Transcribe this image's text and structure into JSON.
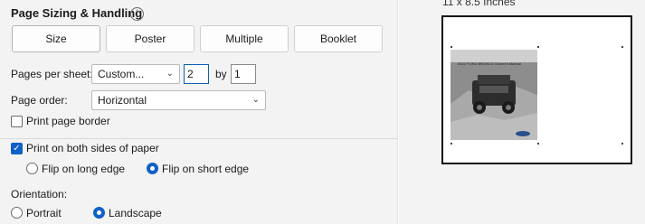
{
  "section": {
    "title": "Page Sizing & Handling",
    "info_glyph": "i"
  },
  "mode_buttons": [
    {
      "label": "Size",
      "active": true
    },
    {
      "label": "Poster",
      "active": false
    },
    {
      "label": "Multiple",
      "active": false
    },
    {
      "label": "Booklet",
      "active": false
    }
  ],
  "pages_per_sheet": {
    "label": "Pages per sheet:",
    "selected": "Custom...",
    "columns": "2",
    "by_label": "by",
    "rows": "1"
  },
  "page_order": {
    "label": "Page order:",
    "selected": "Horizontal"
  },
  "print_page_border": {
    "label": "Print page border",
    "checked": false
  },
  "duplex": {
    "label": "Print on both sides of paper",
    "checked": true,
    "options": [
      {
        "label": "Flip on long edge",
        "selected": false
      },
      {
        "label": "Flip on short edge",
        "selected": true
      }
    ]
  },
  "orientation": {
    "label": "Orientation:",
    "options": [
      {
        "label": "Portrait",
        "selected": false
      },
      {
        "label": "Landscape",
        "selected": true
      }
    ]
  },
  "preview": {
    "paper_size": "11 x 8.5 Inches",
    "cover_title": "2022 FORD BRONCO Owner's Manual"
  },
  "colors": {
    "accent": "#1060c8",
    "panel_bg": "#f3f3f3"
  }
}
